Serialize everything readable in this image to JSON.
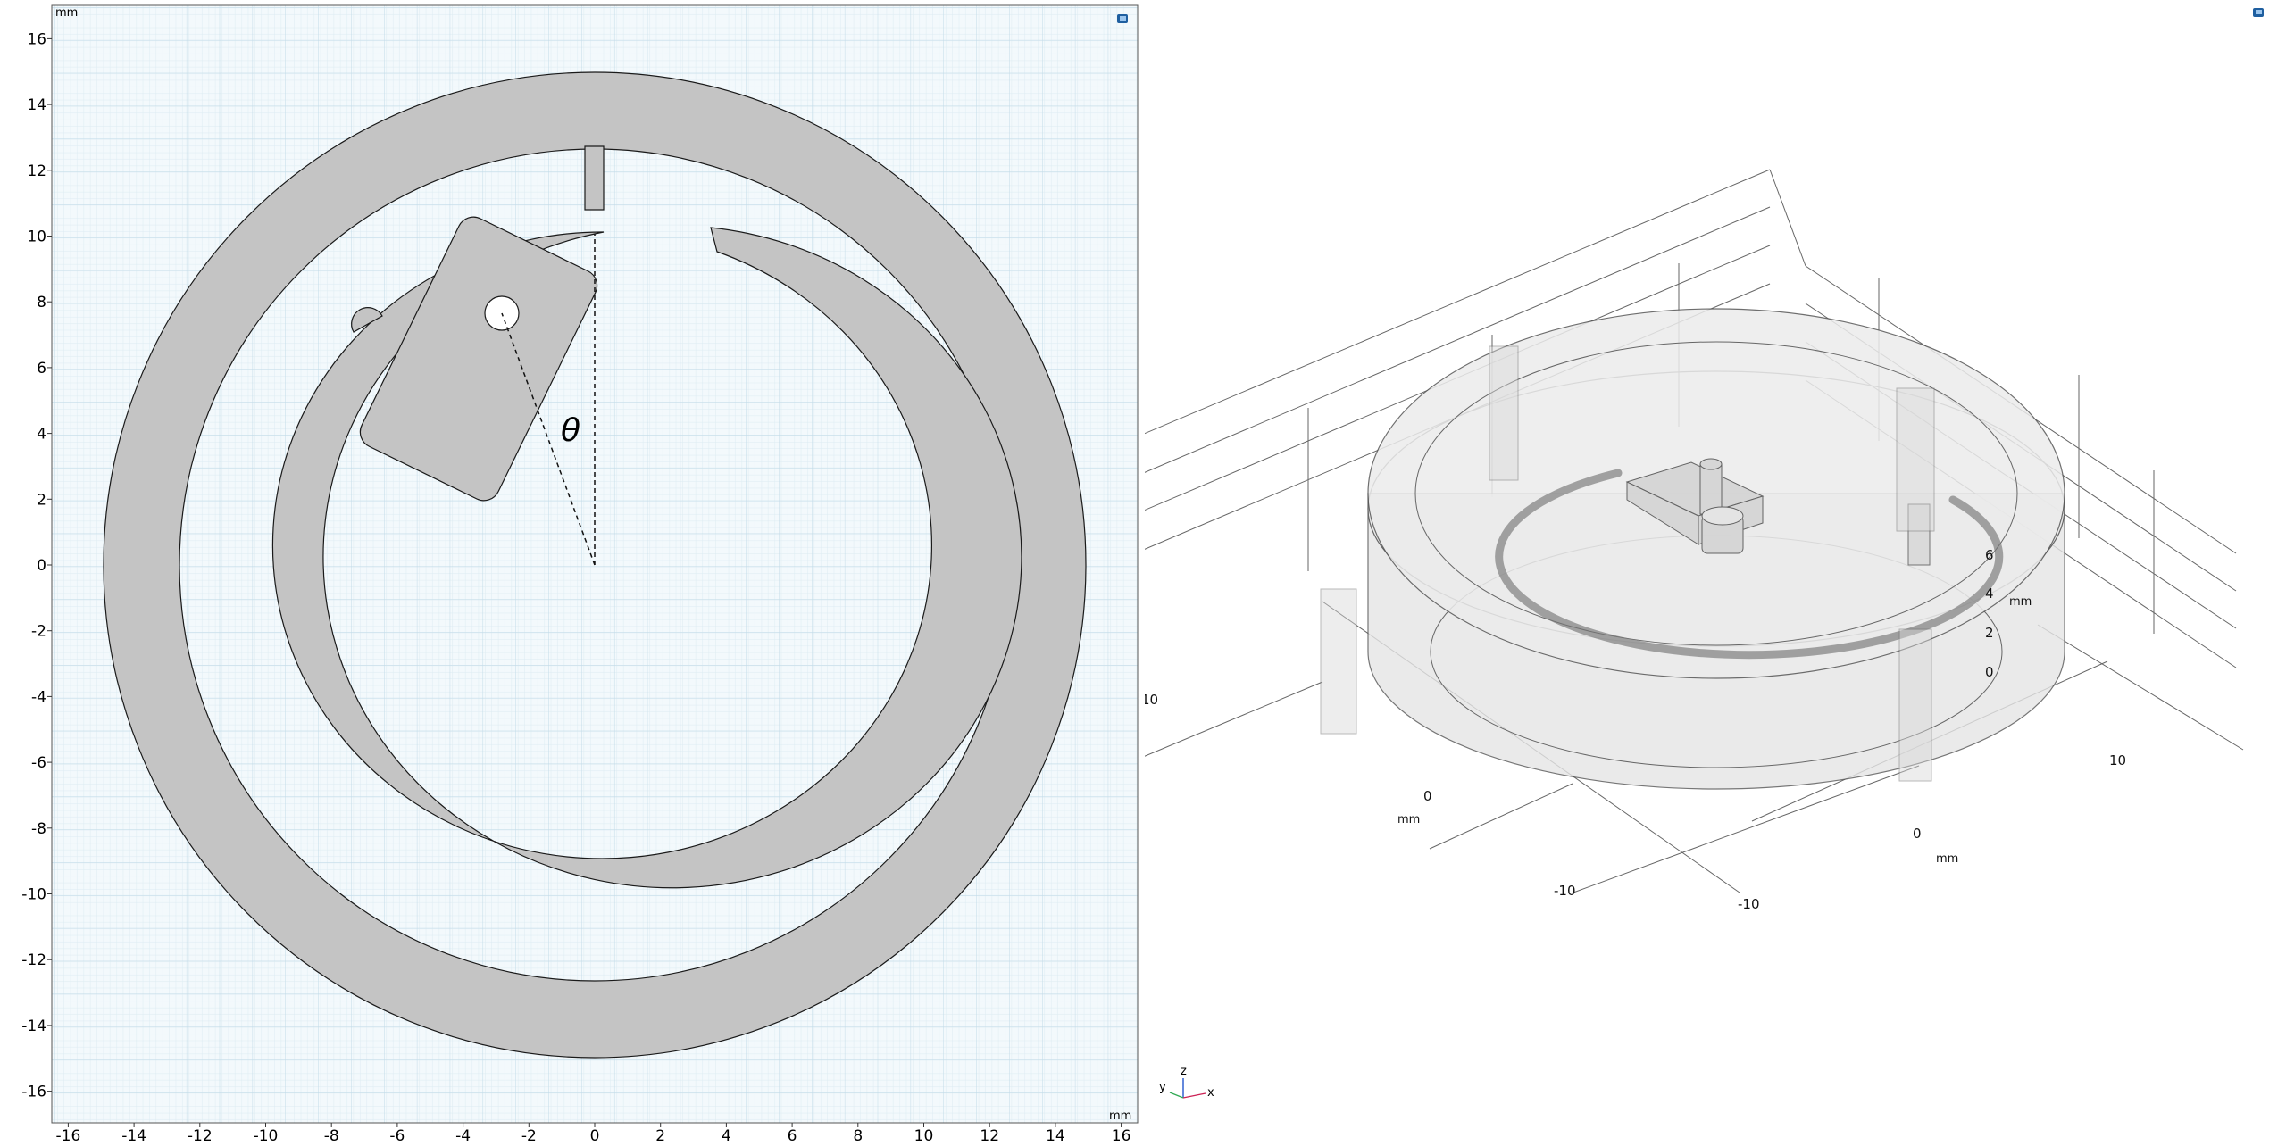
{
  "left_view": {
    "unit_top": "mm",
    "unit_bottom": "mm",
    "angle_symbol": "θ",
    "x_ticks": [
      "-16",
      "-14",
      "-12",
      "-10",
      "-8",
      "-6",
      "-4",
      "-2",
      "0",
      "2",
      "4",
      "6",
      "8",
      "10",
      "12",
      "14",
      "16"
    ],
    "y_ticks": [
      "16",
      "14",
      "12",
      "10",
      "8",
      "6",
      "4",
      "2",
      "0",
      "-2",
      "-4",
      "-6",
      "-8",
      "-10",
      "-12",
      "-14",
      "-16"
    ]
  },
  "right_view": {
    "unit_z": "mm",
    "unit_x": "mm",
    "unit_y": "mm",
    "z_ticks": [
      "6",
      "4",
      "2",
      "0"
    ],
    "x_ticks": [
      "10",
      "0",
      "-10"
    ],
    "y_ticks": [
      "10",
      "0",
      "-10"
    ],
    "triad": {
      "z": "z",
      "y": "y",
      "x": "x"
    }
  },
  "colors": {
    "grid_minor": "#dcebf2",
    "grid_major": "#c2dbe8",
    "plot_bg": "#f3f9fc",
    "geometry_fill": "#c4c4c4",
    "outline": "#1a1a1a",
    "axis_x": "#cc2255",
    "axis_y": "#33aa55",
    "axis_z": "#2255cc"
  }
}
